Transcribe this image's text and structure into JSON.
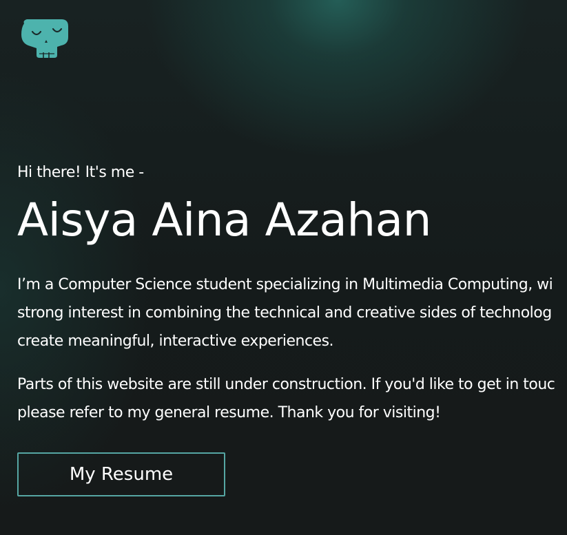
{
  "logo": {
    "icon": "skull-icon",
    "color": "#4db3ad"
  },
  "hero": {
    "greeting": "Hi there! It's me -",
    "name": "Aisya Aina Azahan",
    "paragraph_1": [
      "I’m a Computer Science student specializing in Multimedia Computing, wi",
      "strong interest in combining the technical and creative sides of technolog",
      "create meaningful, interactive experiences."
    ],
    "paragraph_2": [
      "Parts of this website are still under construction. If you'd like to get in touc",
      "please refer to my general resume. Thank you for visiting!"
    ],
    "resume_button_label": "My Resume"
  },
  "colors": {
    "background": "#151b1b",
    "accent": "#56a7a4",
    "text": "#ffffff"
  }
}
